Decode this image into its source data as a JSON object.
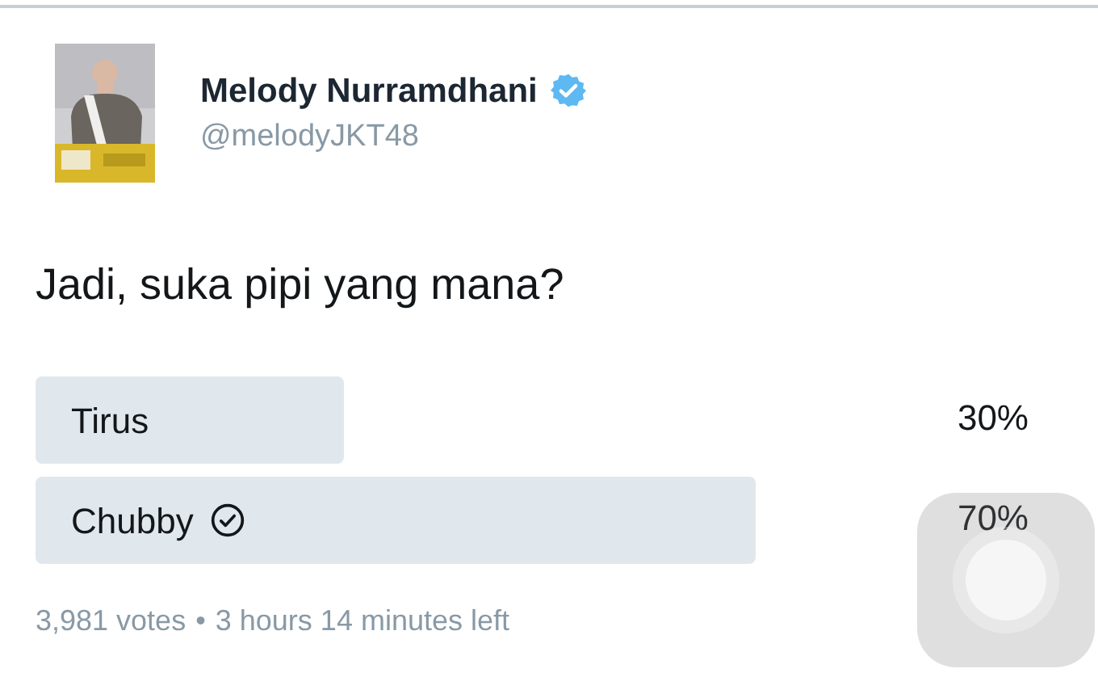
{
  "tweet": {
    "author": {
      "name": "Melody Nurramdhani",
      "verified": true,
      "handle": "@melodyJKT48"
    },
    "text": "Jadi, suka pipi yang mana?",
    "poll": {
      "choices": [
        {
          "label": "Tirus",
          "percent": "30%",
          "level": 0.3,
          "selected": false
        },
        {
          "label": "Chubby",
          "percent": "70%",
          "level": 0.7,
          "selected": true
        }
      ],
      "votes": "3,981 votes",
      "separator": "•",
      "time_left": "3 hours 14 minutes left"
    }
  }
}
